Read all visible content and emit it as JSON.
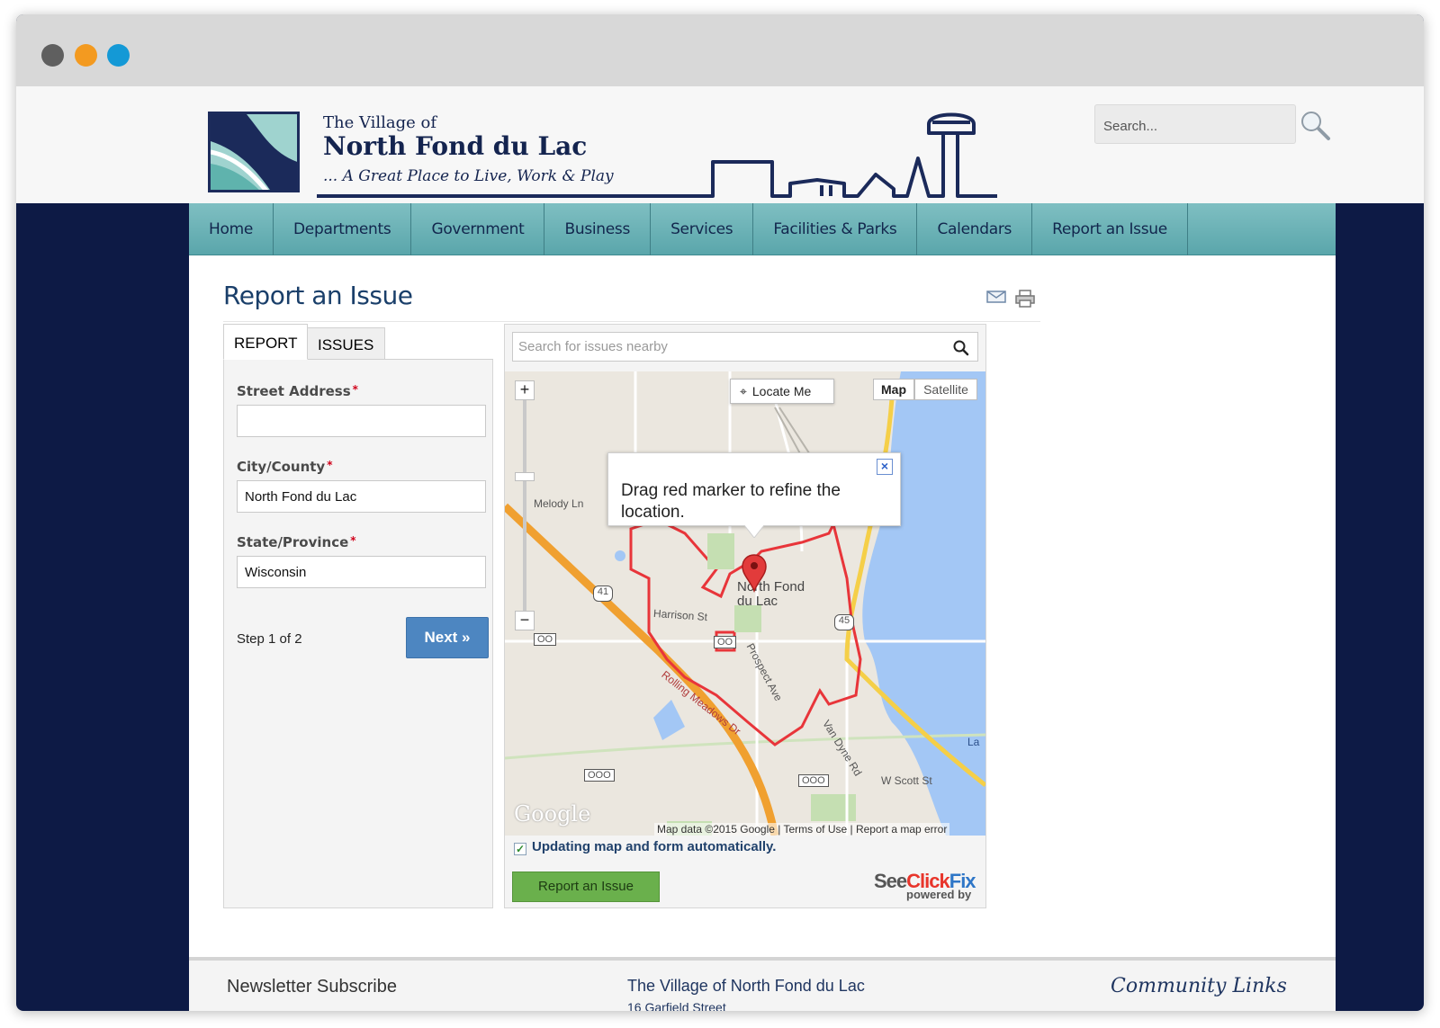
{
  "window": {
    "controls": [
      "close",
      "minimize",
      "zoom"
    ]
  },
  "header": {
    "logo_small": "The Village of",
    "logo_big": "North Fond du Lac",
    "tagline": "... A Great Place to Live, Work & Play",
    "search_placeholder": "Search..."
  },
  "nav": {
    "items": [
      "Home",
      "Departments",
      "Government",
      "Business",
      "Services",
      "Facilities & Parks",
      "Calendars",
      "Report an Issue"
    ]
  },
  "page": {
    "title": "Report an Issue",
    "tools": [
      "email-icon",
      "print-icon"
    ]
  },
  "form": {
    "tabs": [
      "REPORT",
      "ISSUES"
    ],
    "street_label": "Street Address",
    "street_value": "",
    "city_label": "City/County",
    "city_value": "North Fond du Lac",
    "state_label": "State/Province",
    "state_value": "Wisconsin",
    "required_mark": "*",
    "step": "Step 1 of 2",
    "next": "Next »"
  },
  "map": {
    "search_placeholder": "Search for issues nearby",
    "locate": "Locate Me",
    "zoom_in": "+",
    "zoom_out": "−",
    "type_map": "Map",
    "type_satellite": "Satellite",
    "info_text": "Drag red marker to refine the location.",
    "info_close": "×",
    "labels": {
      "melody": "Melody Ln",
      "town": "North Fond du Lac",
      "harrison": "Harrison St",
      "prospect": "Prospect Ave",
      "rolling": "Rolling Meadows Dr",
      "vandyne": "Van Dyne Rd",
      "scott": "W Scott St",
      "la": "La",
      "r41": "41",
      "r45": "45",
      "r00a": "OO",
      "r00b": "OO",
      "r000a": "OOO",
      "r000b": "OOO"
    },
    "google": "Google",
    "attrib": "Map data ©2015 Google  |  Terms of Use  |  Report a map error",
    "auto_update": "Updating map and form automatically.",
    "report_button": "Report an Issue",
    "brand_see": "See",
    "brand_click": "Click",
    "brand_fix": "Fix",
    "brand_sub": "powered by"
  },
  "footer": {
    "newsletter": "Newsletter Subscribe",
    "village": "The Village of North Fond du Lac",
    "address": "16 Garfield Street",
    "community": "Community Links"
  },
  "colors": {
    "page_bg": "#0d1a45",
    "nav": "#6bb0b5",
    "title": "#1a3f6a",
    "next_button": "#4d86c1",
    "report_button": "#6ab04c",
    "boundary": "#e8353a",
    "highway": "#f0a030"
  }
}
